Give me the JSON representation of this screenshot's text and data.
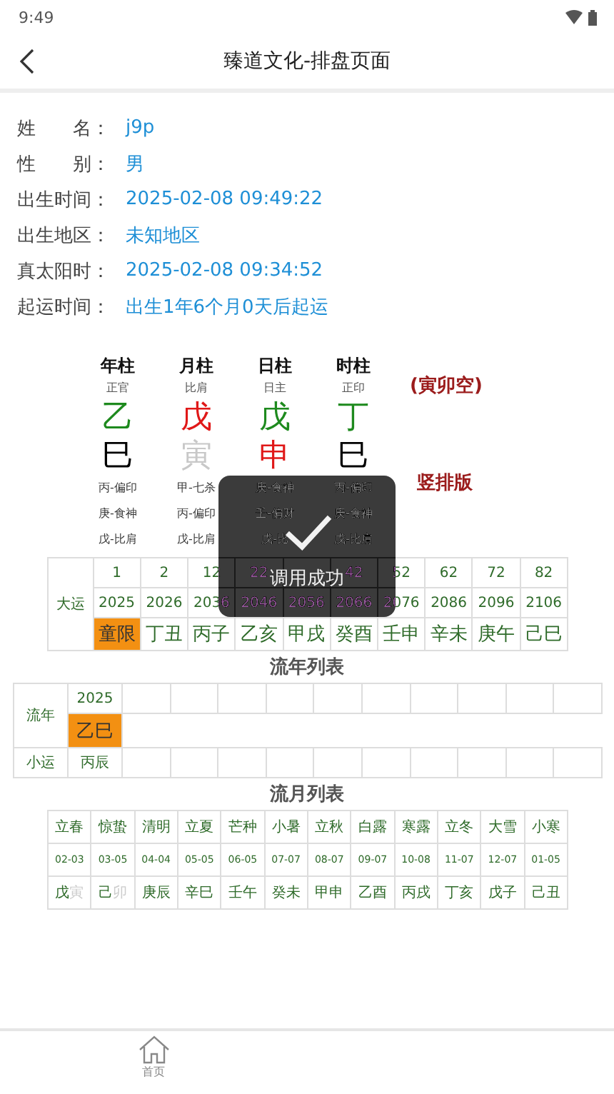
{
  "status_bar": {
    "time": "9:49"
  },
  "header": {
    "title": "臻道文化-排盘页面"
  },
  "info": [
    {
      "label": "姓　　名：",
      "value": "j9p"
    },
    {
      "label": "性　　别：",
      "value": "男"
    },
    {
      "label": "出生时间：",
      "value": "2025-02-08 09:49:22"
    },
    {
      "label": "出生地区：",
      "value": "未知地区"
    },
    {
      "label": "真太阳时：",
      "value": "2025-02-08 09:34:52"
    },
    {
      "label": "起运时间：",
      "value": "出生1年6个月0天后起运"
    }
  ],
  "pillars": [
    {
      "title": "年柱",
      "shishen": "正官",
      "stem": {
        "char": "乙",
        "color": "#1e8a1e"
      },
      "branch": {
        "char": "巳",
        "color": "#000000"
      },
      "hidden": [
        "丙-偏印",
        "庚-食神",
        "戊-比肩"
      ]
    },
    {
      "title": "月柱",
      "shishen": "比肩",
      "stem": {
        "char": "戊",
        "color": "#e01818"
      },
      "branch": {
        "char": "寅",
        "color": "#c8c8c8"
      },
      "hidden": [
        "甲-七杀",
        "丙-偏印",
        "戊-比肩"
      ]
    },
    {
      "title": "日柱",
      "shishen": "日主",
      "stem": {
        "char": "戊",
        "color": "#1e8a1e"
      },
      "branch": {
        "char": "申",
        "color": "#e01818"
      },
      "hidden": [
        "庚-食神",
        "壬-偏财",
        "戊-比"
      ]
    },
    {
      "title": "时柱",
      "shishen": "正印",
      "stem": {
        "char": "丁",
        "color": "#1e8a1e"
      },
      "branch": {
        "char": "巳",
        "color": "#000000"
      },
      "hidden": [
        "丙-偏印",
        "庚-食神",
        "戊-比肩"
      ]
    }
  ],
  "kongwang": "(寅卯空)",
  "layout_toggle": "竖排版",
  "dayun": {
    "label": "大运",
    "items": [
      {
        "age": "1",
        "year": "2025",
        "ganzhi": "童限",
        "selected": true
      },
      {
        "age": "2",
        "year": "2026",
        "ganzhi": "丁丑",
        "selected": false
      },
      {
        "age": "12",
        "year": "2036",
        "ganzhi": "丙子",
        "selected": false
      },
      {
        "age": "22",
        "year": "2046",
        "ganzhi": "乙亥",
        "selected": false
      },
      {
        "year": "2056",
        "ganzhi": "甲戌",
        "selected": false
      },
      {
        "age": "42",
        "year": "2066",
        "ganzhi": "癸酉",
        "selected": false
      },
      {
        "age": "52",
        "year": "2076",
        "ganzhi": "壬申",
        "selected": false
      },
      {
        "age": "62",
        "year": "2086",
        "ganzhi": "辛未",
        "selected": false
      },
      {
        "age": "72",
        "year": "2096",
        "ganzhi": "庚午",
        "selected": false
      },
      {
        "age": "82",
        "year": "2106",
        "ganzhi": "己巳",
        "selected": false
      }
    ]
  },
  "liunian": {
    "title": "流年列表",
    "label": "流年",
    "xiaoyun_label": "小运",
    "years": [
      {
        "year": "2025",
        "ganzhi": "乙巳",
        "xiaoyun": "丙辰",
        "selected": true
      }
    ]
  },
  "liuyue": {
    "title": "流月列表",
    "months": [
      {
        "term": "立春",
        "date": "02-03",
        "stem": "戊",
        "branch": "寅",
        "faded": true
      },
      {
        "term": "惊蛰",
        "date": "03-05",
        "stem": "己",
        "branch": "卯",
        "faded": true
      },
      {
        "term": "清明",
        "date": "04-04",
        "stem": "庚",
        "branch": "辰",
        "faded": false
      },
      {
        "term": "立夏",
        "date": "05-05",
        "stem": "辛",
        "branch": "巳",
        "faded": false
      },
      {
        "term": "芒种",
        "date": "06-05",
        "stem": "壬",
        "branch": "午",
        "faded": false
      },
      {
        "term": "小暑",
        "date": "07-07",
        "stem": "癸",
        "branch": "未",
        "faded": false
      },
      {
        "term": "立秋",
        "date": "08-07",
        "stem": "甲",
        "branch": "申",
        "faded": false
      },
      {
        "term": "白露",
        "date": "09-07",
        "stem": "乙",
        "branch": "酉",
        "faded": false
      },
      {
        "term": "寒露",
        "date": "10-08",
        "stem": "丙",
        "branch": "戌",
        "faded": false
      },
      {
        "term": "立冬",
        "date": "11-07",
        "stem": "丁",
        "branch": "亥",
        "faded": false
      },
      {
        "term": "大雪",
        "date": "12-07",
        "stem": "戊",
        "branch": "子",
        "faded": false
      },
      {
        "term": "小寒",
        "date": "01-05",
        "stem": "己",
        "branch": "丑",
        "faded": false
      }
    ]
  },
  "toast": {
    "message": "调用成功"
  },
  "nav": [
    {
      "label": "首页",
      "kind": "home"
    }
  ]
}
